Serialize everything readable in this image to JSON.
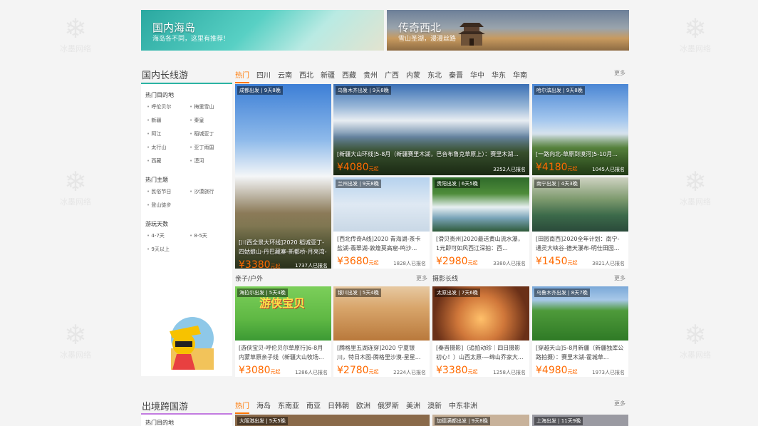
{
  "watermark": "冰墨网络",
  "banners": [
    {
      "title": "国内海岛",
      "sub": "海岛各不同，这里有推荐！"
    },
    {
      "title": "传奇西北",
      "sub": "雪山圣湖，漫漫丝路"
    }
  ],
  "domestic": {
    "title": "国内长线游",
    "tabs": [
      "热门",
      "四川",
      "云南",
      "西北",
      "新疆",
      "西藏",
      "贵州",
      "广西",
      "内蒙",
      "东北",
      "秦晋",
      "华中",
      "华东",
      "华南"
    ],
    "more": "更多",
    "sidebar": {
      "sections": [
        {
          "title": "热门目的地",
          "items": [
            "呼伦贝尔",
            "梅里雪山",
            "新疆",
            "秦皇",
            "阿江",
            "稻城亚丁",
            "太行山",
            "亚丁雨国",
            "西藏",
            "漠河"
          ]
        },
        {
          "title": "热门主题",
          "items": [
            "民俗节日",
            "沙漠旅行",
            "登山徒步"
          ]
        },
        {
          "title": "游玩天数",
          "items": [
            "4-7天",
            "8-5天",
            "9天以上"
          ]
        }
      ]
    },
    "cards": [
      {
        "tag": "成都出发 | 9天8晚",
        "title": "[川西全景大环线]2020 稻城亚丁-四姑娘山-丹巴藏寨-新都桥-月亮湾-毕棚沟...",
        "price": "3380",
        "unit": "元起",
        "sold": "1737人已报名"
      },
      {
        "tag": "乌鲁木齐出发 | 9天8晚",
        "title": "[新疆大山环线]5-8月（新疆赛里木湖，巴音布鲁克草原上）：赛里木湖...",
        "price": "4080",
        "unit": "元起",
        "sold": "3252人已报名"
      },
      {
        "tag": "哈尔滨出发 | 9天8晚",
        "title": "[一路向北-草原到漠河]5-10月...",
        "price": "4180",
        "unit": "元起",
        "sold": "1045人已报名"
      },
      {
        "tag": "兰州出发 | 9天8晚",
        "title": "[西北传奇A线]2020 青海湖-茶卡盐湖-翡翠湖-敦煌莫高窟-鸣沙...",
        "price": "3680",
        "unit": "元起",
        "sold": "1828人已报名"
      },
      {
        "tag": "贵阳出发 | 6天5晚",
        "title": "[滑贝贵州]2020最送黄山流水瀑，1元即可如风西江深拍：西...",
        "price": "2980",
        "unit": "元起",
        "sold": "3380人已报名"
      },
      {
        "tag": "南宁出发 | 4天3晚",
        "title": "[田园南西]2020全年计划：南宁-通灵大峡谷-德天瀑布-明仕田园...",
        "price": "1450",
        "unit": "元起",
        "sold": "3821人已报名"
      }
    ]
  },
  "family": {
    "title": "亲子/户外",
    "more": "更多",
    "cards": [
      {
        "tag": "海拉尔出发 | 5天4晚",
        "title": "[游侠宝贝-呼伦贝尔草原行]6-8月内蒙草原亲子线（新疆大山牧场...",
        "price": "3080",
        "unit": "元起",
        "sold": "1286人已报名",
        "art": "游侠宝贝"
      },
      {
        "tag": "银川出发 | 5天4晚",
        "title": "[腾格里五湖连穿]2020 宁夏银川，特日木图-腾格里沙漠-星星...",
        "price": "2780",
        "unit": "元起",
        "sold": "2224人已报名"
      }
    ]
  },
  "photo": {
    "title": "摄影长线",
    "more": "更多",
    "cards": [
      {
        "tag": "太原出发 | 7天6晚",
        "title": "[秦晋摄影]（追拍动珍｜四日摄影初心！）山西太原-—绵山乔家大...",
        "price": "3380",
        "unit": "元起",
        "sold": "1258人已报名"
      },
      {
        "tag": "乌鲁木齐出发 | 8天7晚",
        "title": "[穿越天山]5-8月新疆（新疆独库公路拍摄）：赛里木湖-霍城草...",
        "price": "4980",
        "unit": "元起",
        "sold": "1973人已报名"
      }
    ]
  },
  "outbound": {
    "title": "出境跨国游",
    "tabs": [
      "热门",
      "海岛",
      "东南亚",
      "南亚",
      "日韩朝",
      "欧洲",
      "俄罗斯",
      "美洲",
      "澳新",
      "中东非洲"
    ],
    "more": "更多",
    "sidebar_title": "热门目的地",
    "card_tags": [
      "大阪港出发 | 5天5晚",
      "加德满都出发 | 9天8晚",
      "上海出发 | 11天9晚"
    ]
  },
  "colors": {
    "accent": "#ff7700",
    "domestic_underline": "#2bb3a3",
    "outbound_underline": "#c37be0",
    "price": "#ff6a00"
  }
}
